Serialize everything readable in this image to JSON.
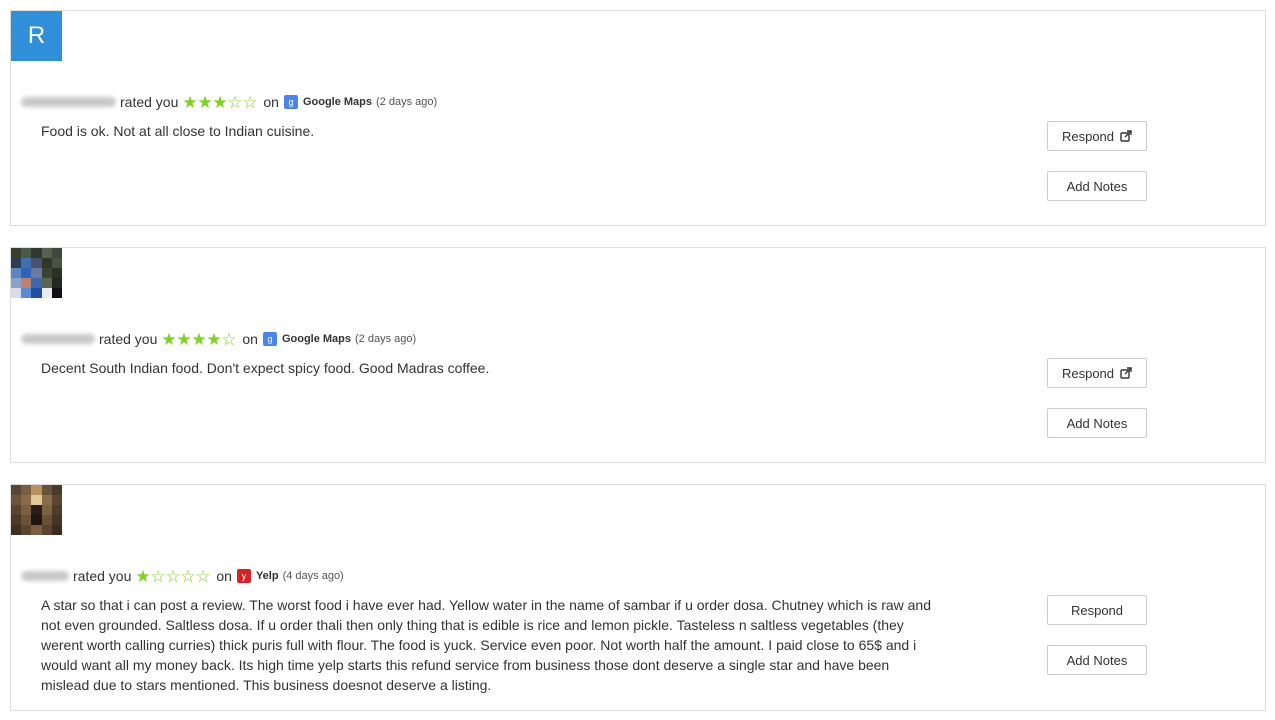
{
  "reviews": [
    {
      "avatar_letter": "R",
      "rated_label": "rated you",
      "rating": 3,
      "max_rating": 5,
      "on_label": "on",
      "source": "Google Maps",
      "source_color": "#4a86e8",
      "source_icon": "google-maps-icon",
      "ago": "(2 days ago)",
      "text": "Food is ok. Not at all close to Indian cuisine.",
      "respond_label": "Respond",
      "respond_has_external_icon": true,
      "notes_label": "Add Notes"
    },
    {
      "avatar_letter": "",
      "rated_label": "rated you",
      "rating": 4,
      "max_rating": 5,
      "on_label": "on",
      "source": "Google Maps",
      "source_color": "#4a86e8",
      "source_icon": "google-maps-icon",
      "ago": "(2 days ago)",
      "text": "Decent South Indian food. Don't expect spicy food. Good Madras coffee.",
      "respond_label": "Respond",
      "respond_has_external_icon": true,
      "notes_label": "Add Notes"
    },
    {
      "avatar_letter": "",
      "rated_label": "rated you",
      "rating": 1,
      "max_rating": 5,
      "on_label": "on",
      "source": "Yelp",
      "source_color": "#d32323",
      "source_icon": "yelp-icon",
      "ago": "(4 days ago)",
      "text": "A star so that i can post a review. The worst food i have ever had. Yellow water in the name of sambar if u order dosa. Chutney which is raw and not even grounded. Saltless dosa. If u order thali then only thing that is edible is rice and lemon pickle. Tasteless n saltless vegetables (they werent worth calling curries) thick puris full with flour. The food is yuck. Service even poor. Not worth half the amount. I paid close to 65$ and i would want all my money back. Its high time yelp starts this refund service from business those dont deserve a single star and have been mislead due to stars mentioned. This business doesnot deserve a listing.",
      "respond_label": "Respond",
      "respond_has_external_icon": false,
      "notes_label": "Add Notes"
    }
  ],
  "colors": {
    "star": "#7ed321",
    "avatar_blue": "#2f8fd8",
    "border": "#dddddd"
  }
}
